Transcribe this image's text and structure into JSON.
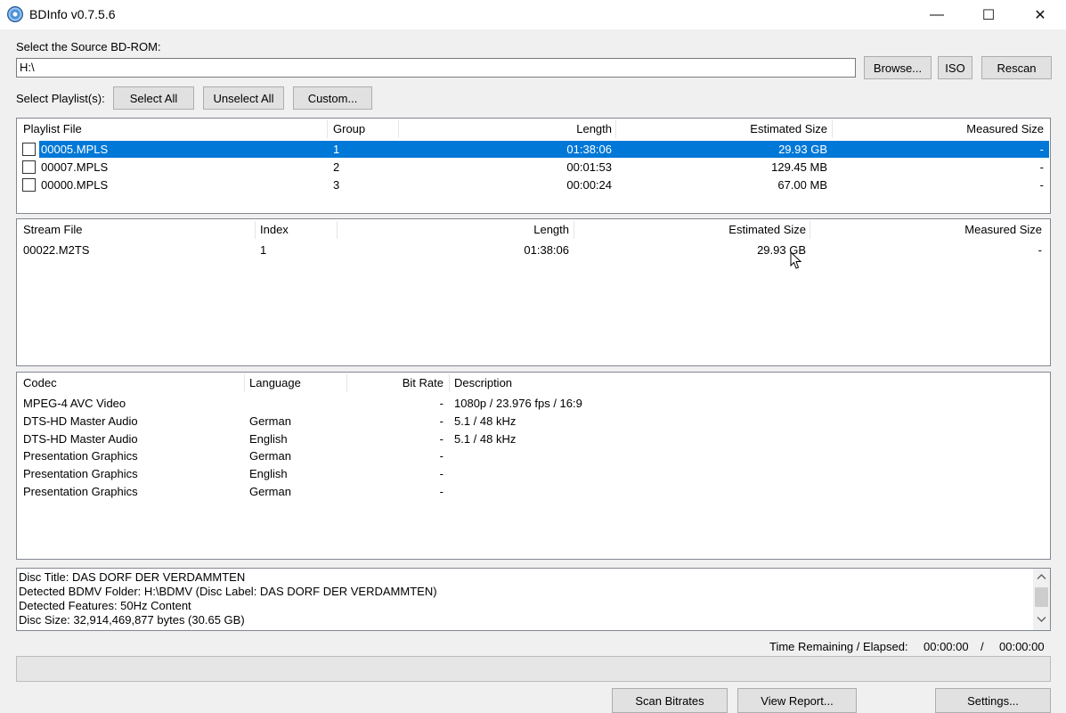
{
  "window": {
    "title": "BDInfo v0.7.5.6",
    "minimize_glyph": "—",
    "maximize_glyph": "☐",
    "close_glyph": "✕"
  },
  "source": {
    "label": "Select the Source BD-ROM:",
    "path_value": "H:\\",
    "browse_label": "Browse...",
    "iso_label": "ISO",
    "rescan_label": "Rescan"
  },
  "playlist_select": {
    "label": "Select Playlist(s):",
    "select_all_label": "Select All",
    "unselect_all_label": "Unselect All",
    "custom_label": "Custom..."
  },
  "playlists": {
    "columns": [
      "Playlist File",
      "Group",
      "Length",
      "Estimated Size",
      "Measured Size"
    ],
    "rows": [
      {
        "file": "00005.MPLS",
        "group": "1",
        "length": "01:38:06",
        "estimated_size": "29.93 GB",
        "measured_size": "-",
        "selected": true
      },
      {
        "file": "00007.MPLS",
        "group": "2",
        "length": "00:01:53",
        "estimated_size": "129.45 MB",
        "measured_size": "-",
        "selected": false
      },
      {
        "file": "00000.MPLS",
        "group": "3",
        "length": "00:00:24",
        "estimated_size": "67.00 MB",
        "measured_size": "-",
        "selected": false
      }
    ]
  },
  "streams": {
    "columns": [
      "Stream File",
      "Index",
      "Length",
      "Estimated Size",
      "Measured Size"
    ],
    "rows": [
      {
        "file": "00022.M2TS",
        "index": "1",
        "length": "01:38:06",
        "estimated_size": "29.93 GB",
        "measured_size": "-"
      }
    ]
  },
  "codecs": {
    "columns": [
      "Codec",
      "Language",
      "Bit Rate",
      "Description"
    ],
    "rows": [
      {
        "codec": "MPEG-4 AVC Video",
        "language": "",
        "bitrate": "-",
        "description": "1080p / 23.976 fps / 16:9"
      },
      {
        "codec": "DTS-HD Master Audio",
        "language": "German",
        "bitrate": "-",
        "description": "5.1 / 48 kHz"
      },
      {
        "codec": "DTS-HD Master Audio",
        "language": "English",
        "bitrate": "-",
        "description": "5.1 / 48 kHz"
      },
      {
        "codec": "Presentation Graphics",
        "language": "German",
        "bitrate": "-",
        "description": ""
      },
      {
        "codec": "Presentation Graphics",
        "language": "English",
        "bitrate": "-",
        "description": ""
      },
      {
        "codec": "Presentation Graphics",
        "language": "German",
        "bitrate": "-",
        "description": ""
      }
    ]
  },
  "disc_info": {
    "lines": [
      "Disc Title: DAS DORF DER VERDAMMTEN",
      "Detected BDMV Folder: H:\\BDMV (Disc Label: DAS DORF DER VERDAMMTEN)",
      "Detected Features: 50Hz Content",
      "Disc Size: 32,914,469,877 bytes (30.65 GB)"
    ]
  },
  "status": {
    "time_label": "Time Remaining / Elapsed:",
    "time_remaining": "00:00:00",
    "separator": "/",
    "time_elapsed": "00:00:00",
    "progress": 0
  },
  "actions": {
    "scan_bitrates_label": "Scan Bitrates",
    "view_report_label": "View Report...",
    "settings_label": "Settings..."
  },
  "icons": {
    "app": "disc-icon",
    "scroll_up": "chevron-up-icon",
    "scroll_down": "chevron-down-icon",
    "cursor": "mouse-pointer-icon"
  },
  "colors": {
    "selection": "#0078d7",
    "window_bg": "#f0f0f0"
  }
}
